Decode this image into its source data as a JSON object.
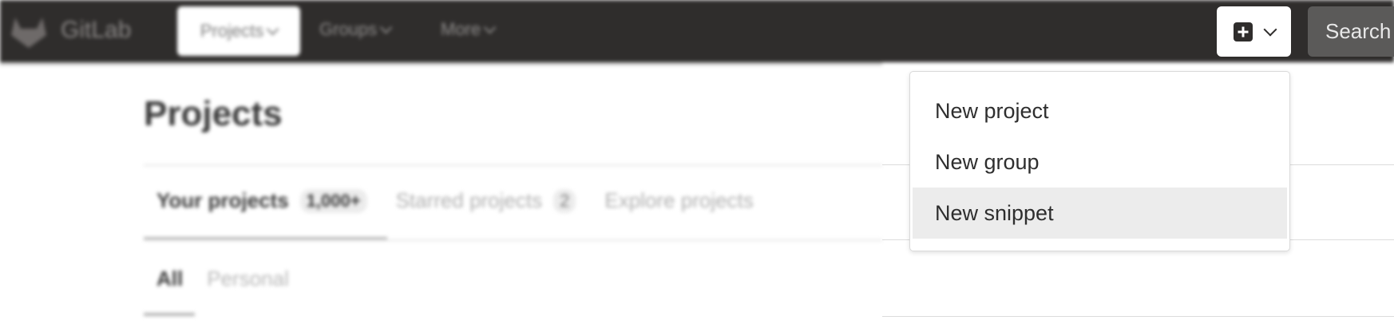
{
  "navbar": {
    "brand": "GitLab",
    "items": [
      {
        "label": "Projects",
        "active": true
      },
      {
        "label": "Groups"
      },
      {
        "label": "More"
      }
    ],
    "search_placeholder": "Search"
  },
  "page": {
    "title": "Projects",
    "tabs": [
      {
        "label": "Your projects",
        "count": "1,000+",
        "active": true
      },
      {
        "label": "Starred projects",
        "count": "2"
      },
      {
        "label": "Explore projects"
      }
    ],
    "subtabs": [
      {
        "label": "All",
        "active": true
      },
      {
        "label": "Personal"
      }
    ]
  },
  "new_menu": {
    "items": [
      {
        "label": "New project"
      },
      {
        "label": "New group"
      },
      {
        "label": "New snippet",
        "highlighted": true
      }
    ]
  },
  "colors": {
    "navbar_bg": "#2f2d2c",
    "highlight_bg": "#ececec"
  },
  "icons": {
    "logo": "gitlab-tanuki-icon",
    "new": "plus-square-icon",
    "dropdown": "chevron-down-icon"
  }
}
